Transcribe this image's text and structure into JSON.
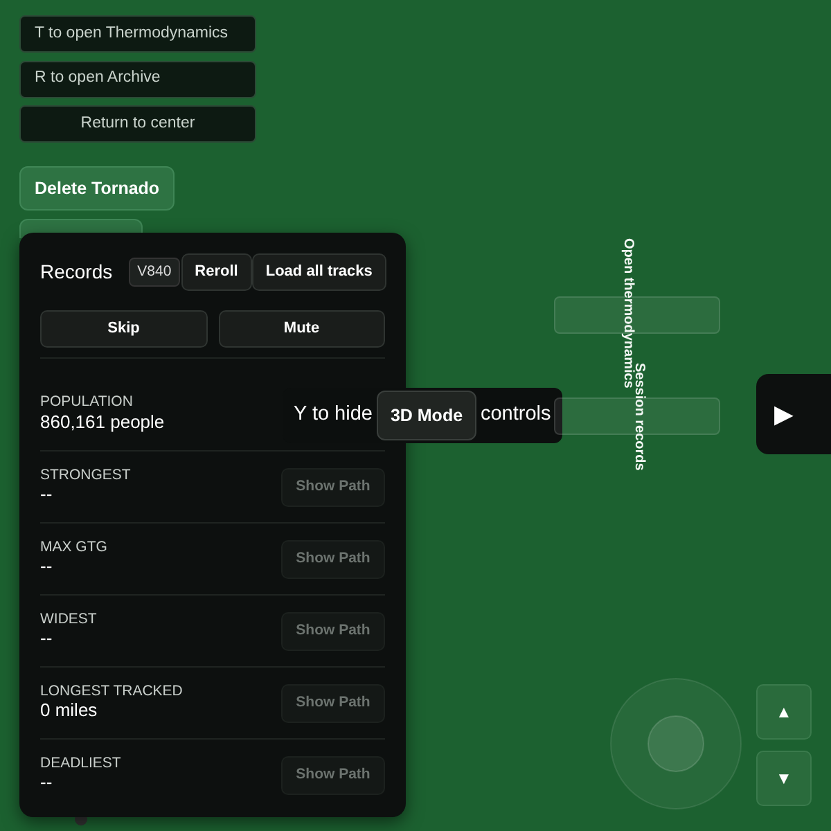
{
  "top_buttons": [
    {
      "label": "T to open Thermodynamics",
      "kind": "hotkey"
    },
    {
      "label": "R to open Archive",
      "kind": "hotkey"
    },
    {
      "label": "Return to center",
      "kind": "action"
    }
  ],
  "delete_button": {
    "label": "Delete Tornado"
  },
  "records": {
    "title": "Records",
    "version": "V840",
    "header_buttons": [
      "Reroll",
      "Load all tracks"
    ],
    "action_buttons": [
      "Skip",
      "Mute"
    ],
    "rows": [
      {
        "label": "POPULATION",
        "value": "860,161 people"
      },
      {
        "label": "STRONGEST",
        "value": "--",
        "button": "Show Path",
        "disabled": true
      },
      {
        "label": "MAX GTG",
        "value": "--",
        "button": "Show Path",
        "disabled": true
      },
      {
        "label": "WIDEST",
        "value": "--",
        "button": "Show Path",
        "disabled": true
      },
      {
        "label": "LONGEST TRACKED",
        "value": "0 miles",
        "button": "Show Path",
        "disabled": true
      },
      {
        "label": "DEADLIEST",
        "value": "--",
        "button": "Show Path",
        "disabled": true
      }
    ]
  },
  "hint": {
    "before": "Y to hide",
    "after": "controls"
  },
  "mode_button": {
    "label": "3D Mode"
  },
  "side_labels": [
    "Open thermodynamics",
    "Session records"
  ],
  "play_button": {
    "label": "▶"
  },
  "altitude_buttons": [
    {
      "label": "▲"
    },
    {
      "label": "▼"
    }
  ]
}
